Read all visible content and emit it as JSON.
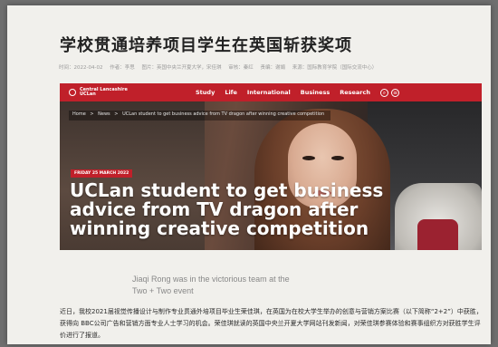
{
  "article": {
    "headline": "学校贯通培养项目学生在英国斩获奖项",
    "meta": {
      "time": "时间：2022-04-02",
      "author": "作者：李思",
      "photo": "图片：英国中央兰开夏大学，宋佳琪",
      "review": "审核：秦红",
      "editor": "责编：谢娟",
      "source": "来源：国际教育学院（国际交流中心）"
    },
    "caption_line1": "Jiaqi Rong was in the victorious team at the",
    "caption_line2": "Two + Two event",
    "body": "近日，我校2021届视觉传播设计与制作专业贯通外培项目毕业生荣佳琪，在英国为在校大学生举办的创意与营销方案比赛（以下简称“2+2”）中获胜，获得向 BBC公司广告和营销方面专业人士学习的机会。荣佳琪就读的英国中央兰开夏大学网站刊发新闻，对荣佳琪参赛体验和赛事组织方对获胜学生评价进行了报道。"
  },
  "screenshot": {
    "logo_line1": "Central Lancashire",
    "logo_line2": "UCLan",
    "nav": [
      "Study",
      "Life",
      "International",
      "Business",
      "Research"
    ],
    "breadcrumb": [
      "Home",
      ">",
      "News",
      ">",
      "UCLan student to get business advice from TV dragon after winning creative competition"
    ],
    "date_badge": "FRIDAY 25 MARCH 2022",
    "title": "UCLan student to get business advice from TV dragon after winning creative competition"
  },
  "colors": {
    "brand_red": "#c0202a",
    "headline": "#222222"
  }
}
